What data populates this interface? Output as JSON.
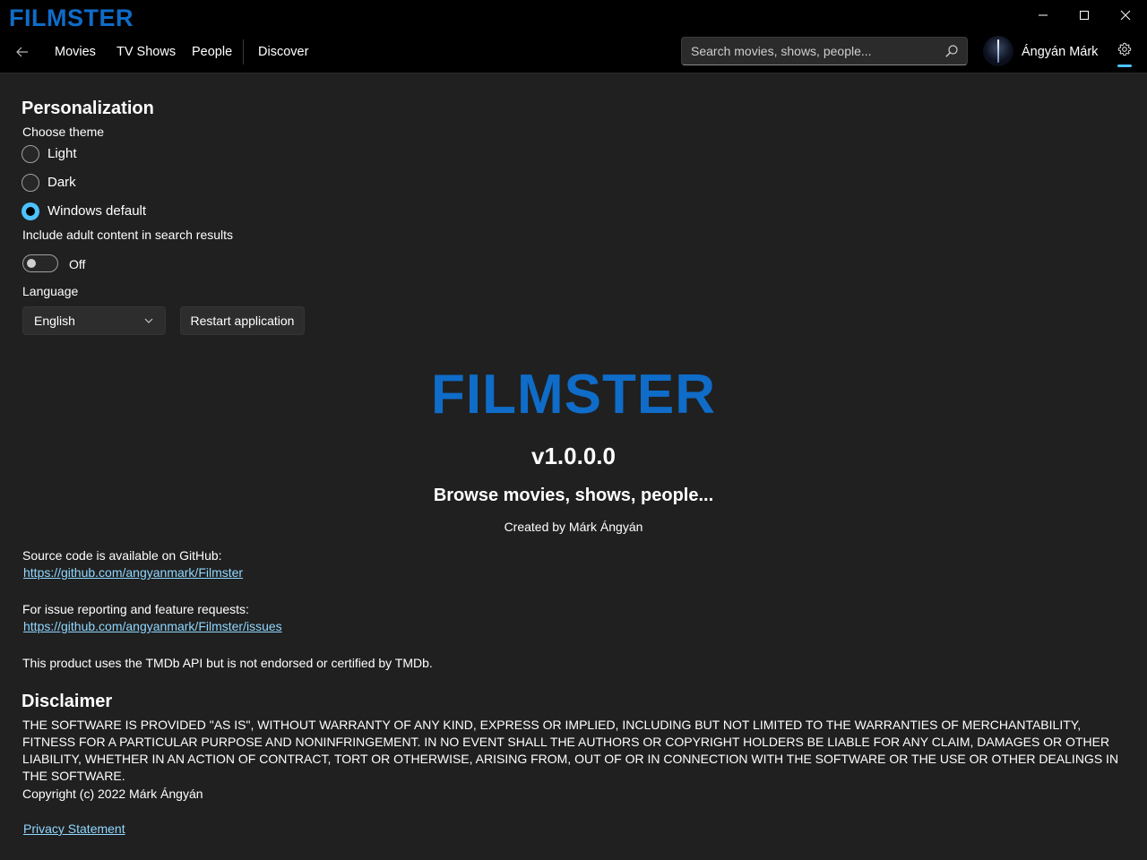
{
  "app": {
    "logo": "FILMSTER"
  },
  "nav": {
    "items": [
      {
        "label": "Movies"
      },
      {
        "label": "TV Shows"
      },
      {
        "label": "People"
      },
      {
        "label": "Discover"
      }
    ],
    "search": {
      "placeholder": "Search movies, shows, people..."
    },
    "user": {
      "name": "Ángyán Márk"
    }
  },
  "personalization": {
    "title": "Personalization",
    "theme_label": "Choose theme",
    "theme_options": [
      {
        "label": "Light",
        "selected": false
      },
      {
        "label": "Dark",
        "selected": false
      },
      {
        "label": "Windows default",
        "selected": true
      }
    ],
    "adult_label": "Include adult content in search results",
    "adult_state": "Off",
    "language_label": "Language",
    "language_value": "English",
    "restart_label": "Restart application"
  },
  "about": {
    "logo": "FILMSTER",
    "version": "v1.0.0.0",
    "tagline": "Browse movies, shows, people...",
    "created_by": "Created by Márk Ángyán",
    "source_label": "Source code is available on GitHub:",
    "source_link": "https://github.com/angyanmark/Filmster",
    "issues_label": "For issue reporting and feature requests:",
    "issues_link": "https://github.com/angyanmark/Filmster/issues",
    "tmdb_notice": "This product uses the TMDb API but is not endorsed or certified by TMDb."
  },
  "disclaimer": {
    "title": "Disclaimer",
    "text": "THE SOFTWARE IS PROVIDED \"AS IS\", WITHOUT WARRANTY OF ANY KIND, EXPRESS OR IMPLIED, INCLUDING BUT NOT LIMITED TO THE WARRANTIES OF MERCHANTABILITY, FITNESS FOR A PARTICULAR PURPOSE AND NONINFRINGEMENT. IN NO EVENT SHALL THE AUTHORS OR COPYRIGHT HOLDERS BE LIABLE FOR ANY CLAIM, DAMAGES OR OTHER LIABILITY, WHETHER IN AN ACTION OF CONTRACT, TORT OR OTHERWISE, ARISING FROM, OUT OF OR IN CONNECTION WITH THE SOFTWARE OR THE USE OR OTHER DEALINGS IN THE SOFTWARE.",
    "copyright": "Copyright (c) 2022 Márk Ángyán",
    "privacy_link": "Privacy Statement"
  },
  "colors": {
    "accent": "#4cc2ff",
    "brand": "#0f6cc8",
    "background": "#202020",
    "link": "#8fd8ff"
  }
}
